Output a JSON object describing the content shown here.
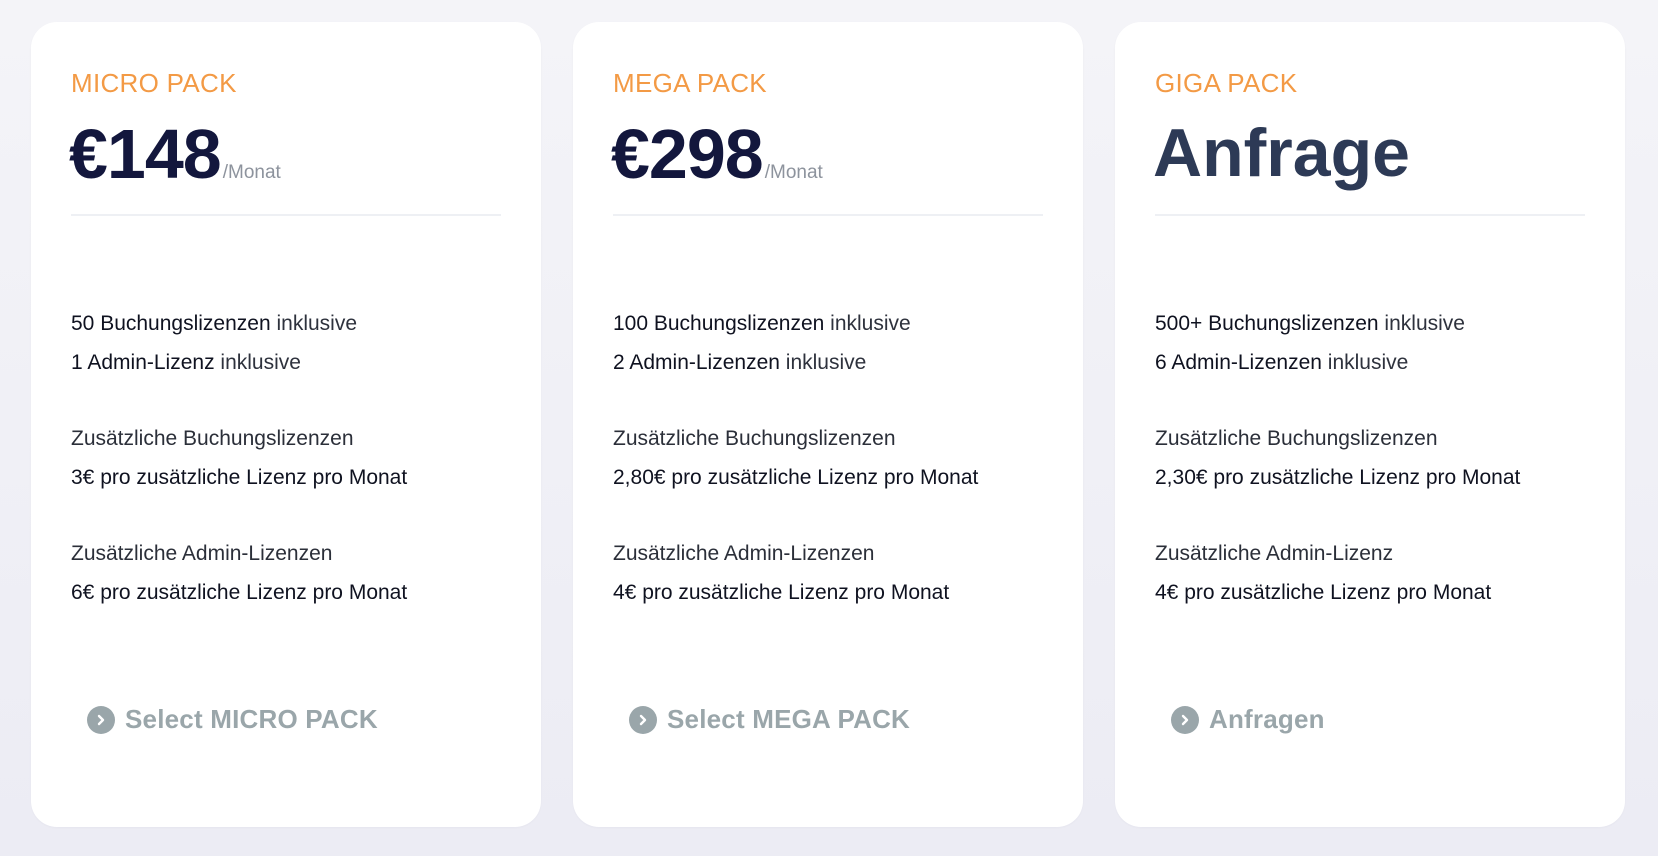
{
  "cards": [
    {
      "name": "MICRO PACK",
      "price": "€148",
      "per": "/Monat",
      "booking_strong": "50 Buchungslizenzen",
      "booking_suffix": " inklusive",
      "admin_strong": "1 Admin-Lizenz",
      "admin_suffix": " inklusive",
      "extra_booking_label": "Zusätzliche Buchungslizenzen",
      "extra_booking_value": "3€ pro zusätzliche Lizenz pro Monat",
      "extra_admin_label": "Zusätzliche Admin-Lizenzen",
      "extra_admin_value": "6€ pro zusätzliche Lizenz pro Monat",
      "cta": "Select MICRO PACK"
    },
    {
      "name": "MEGA PACK",
      "price": "€298",
      "per": "/Monat",
      "booking_strong": "100 Buchungslizenzen",
      "booking_suffix": " inklusive",
      "admin_strong": "2 Admin-Lizenzen",
      "admin_suffix": " inklusive",
      "extra_booking_label": "Zusätzliche Buchungslizenzen",
      "extra_booking_value": "2,80€ pro zusätzliche Lizenz pro Monat",
      "extra_admin_label": "Zusätzliche Admin-Lizenzen",
      "extra_admin_value": "4€ pro zusätzliche Lizenz pro Monat",
      "cta": "Select MEGA PACK"
    },
    {
      "name": "GIGA PACK",
      "price": "Anfrage",
      "booking_strong": "500+ Buchungslizenzen",
      "booking_suffix": " inklusive",
      "admin_strong": "6 Admin-Lizenzen",
      "admin_suffix": " inklusive",
      "extra_booking_label": "Zusätzliche Buchungslizenzen",
      "extra_booking_value": "2,30€ pro zusätzliche Lizenz pro Monat",
      "extra_admin_label": "Zusätzliche Admin-Lizenz",
      "extra_admin_value": "4€ pro zusätzliche Lizenz pro Monat",
      "cta": "Anfragen"
    }
  ],
  "icons": {
    "cta": "chevron-right-circle-icon"
  },
  "colors": {
    "pack_name": "#f39a45",
    "price": "#13173d",
    "cta": "#9aa6aa"
  }
}
